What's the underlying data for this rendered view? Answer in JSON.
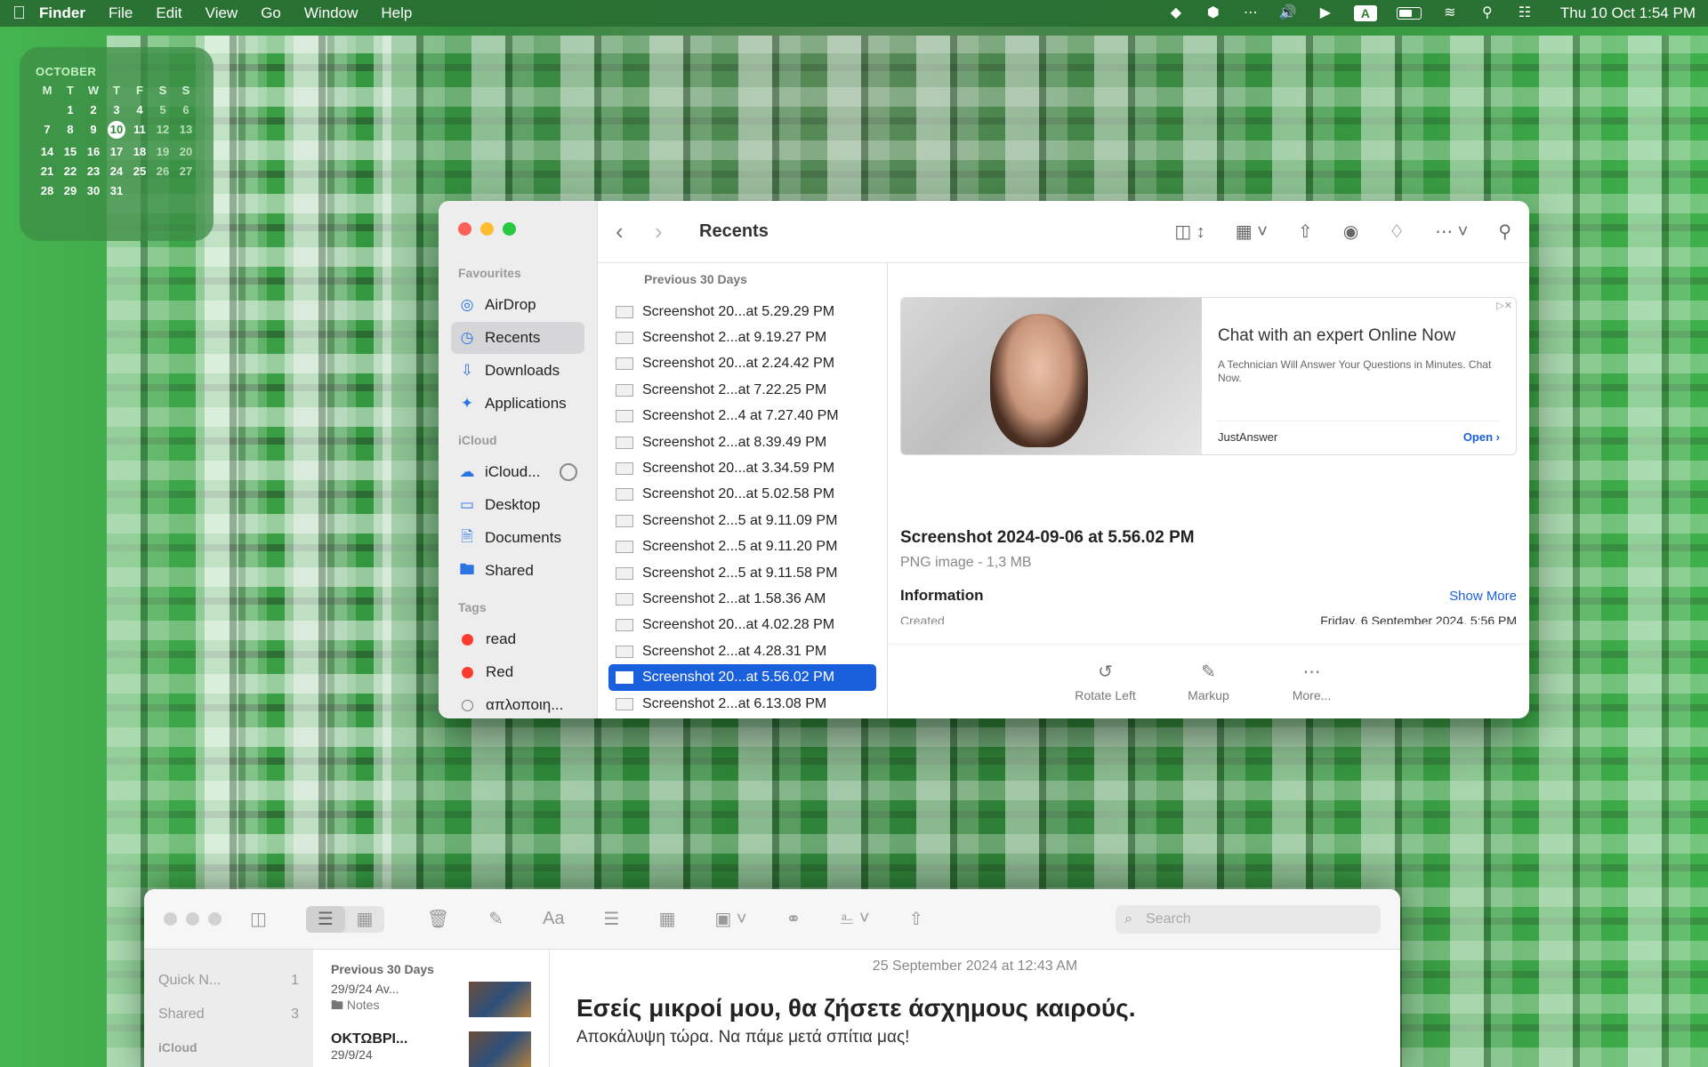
{
  "menubar": {
    "app": "Finder",
    "items": [
      "File",
      "Edit",
      "View",
      "Go",
      "Window",
      "Help"
    ],
    "text_input_badge": "A",
    "clock": "Thu 10 Oct  1:54 PM"
  },
  "calendar": {
    "month": "OCTOBER",
    "weekdays": [
      "M",
      "T",
      "W",
      "T",
      "F",
      "S",
      "S"
    ],
    "today": "10",
    "weeks": [
      [
        "",
        "1",
        "2",
        "3",
        "4",
        "5",
        "6"
      ],
      [
        "7",
        "8",
        "9",
        "10",
        "11",
        "12",
        "13"
      ],
      [
        "14",
        "15",
        "16",
        "17",
        "18",
        "19",
        "20"
      ],
      [
        "21",
        "22",
        "23",
        "24",
        "25",
        "26",
        "27"
      ],
      [
        "28",
        "29",
        "30",
        "31",
        "",
        "",
        ""
      ]
    ]
  },
  "finder": {
    "title": "Recents",
    "sidebar": {
      "favourites_label": "Favourites",
      "favourites": [
        "AirDrop",
        "Recents",
        "Downloads",
        "Applications"
      ],
      "icloud_label": "iCloud",
      "icloud": [
        "iCloud...",
        "Desktop",
        "Documents",
        "Shared"
      ],
      "tags_label": "Tags",
      "tags": [
        "read",
        "Red",
        "απλοποιη..."
      ]
    },
    "list_section": "Previous 30 Days",
    "files": [
      "Screenshot 20...at 5.29.29 PM",
      "Screenshot 2...at 9.19.27 PM",
      "Screenshot 20...at 2.24.42 PM",
      "Screenshot 2...at 7.22.25 PM",
      "Screenshot 2...4 at 7.27.40 PM",
      "Screenshot 2...at 8.39.49 PM",
      "Screenshot 20...at 3.34.59 PM",
      "Screenshot 20...at 5.02.58 PM",
      "Screenshot 2...5 at 9.11.09 PM",
      "Screenshot 2...5 at 9.11.20 PM",
      "Screenshot 2...5 at 9.11.58 PM",
      "Screenshot 2...at 1.58.36 AM",
      "Screenshot 20...at 4.02.28 PM",
      "Screenshot 2...at 4.28.31 PM",
      "Screenshot 20...at 5.56.02 PM",
      "Screenshot 2...at 6.13.08 PM"
    ],
    "selected_index": 14,
    "preview": {
      "ad_headline": "Chat with an expert Online Now",
      "ad_sub": "A Technician Will Answer Your Questions in Minutes. Chat Now.",
      "ad_brand": "JustAnswer",
      "ad_open": "Open",
      "file_name": "Screenshot 2024-09-06 at 5.56.02 PM",
      "file_meta": "PNG image - 1,3 MB",
      "info_label": "Information",
      "show_more": "Show More",
      "created_label": "Created",
      "created_value": "Friday, 6 September 2024, 5:56 PM",
      "actions": [
        "Rotate Left",
        "Markup",
        "More..."
      ]
    }
  },
  "notes": {
    "search_placeholder": "Search",
    "sidebar": [
      {
        "label": "Quick N...",
        "count": "1"
      },
      {
        "label": "Shared",
        "count": "3"
      }
    ],
    "icloud_label": "iCloud",
    "list_section": "Previous 30 Days",
    "list_items": [
      {
        "title": "",
        "date": "29/9/24",
        "preview": "Av...",
        "folder": "Notes"
      },
      {
        "title": "ΟΚΤΩΒΡΙ...",
        "date": "29/9/24",
        "preview": "",
        "folder": ""
      }
    ],
    "note_date": "25 September 2024 at 12:43 AM",
    "note_title": "Εσείς μικροί μου, θα ζήσετε άσχημους καιρούς.",
    "note_body": "Αποκάλυψη τώρα. Να πάμε μετά σπίτια μας!"
  }
}
